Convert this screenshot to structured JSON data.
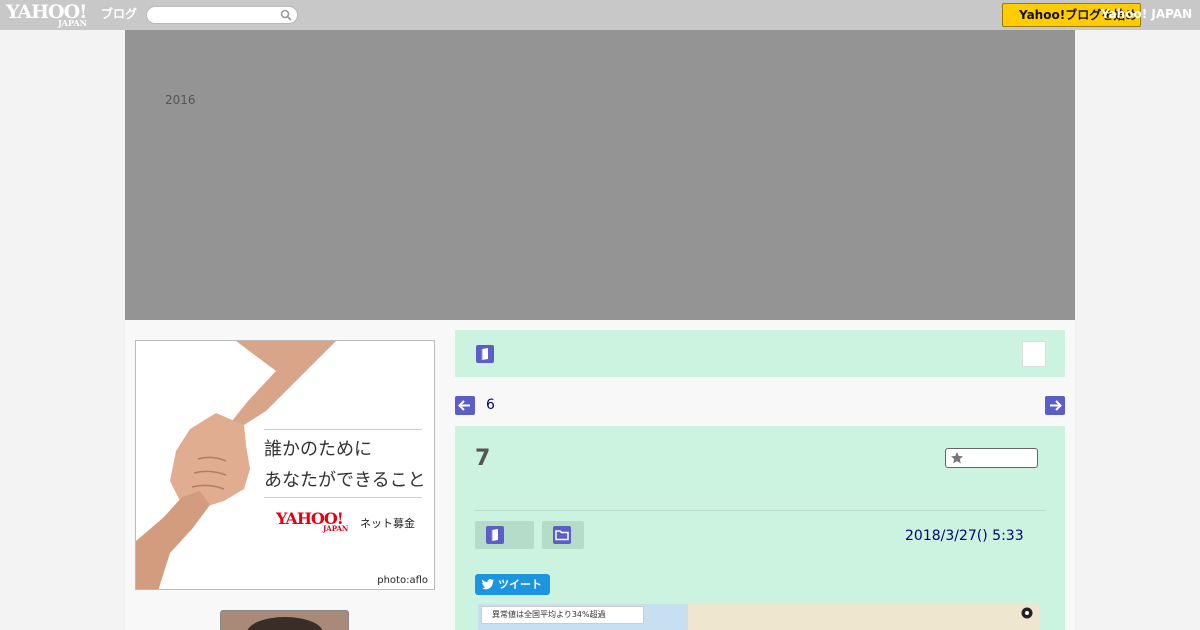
{
  "topbar": {
    "logo_main": "YAHOO!",
    "logo_sub": "JAPAN",
    "logo_blog": "ブログ",
    "search_placeholder": "",
    "button_label": "Yahoo!ブログを始める",
    "link_label": "Yahoo! JAPAN"
  },
  "banner": {
    "year": "2016"
  },
  "sidebar": {
    "ad": {
      "line1": "誰かのために",
      "line2": "あなたができること",
      "logo_main": "YAHOO!",
      "logo_sub": "JAPAN",
      "brand": "ネット募金",
      "credit": "photo:aflo"
    }
  },
  "navigation": {
    "prev_label": "6"
  },
  "article": {
    "title": "7",
    "date": "2018/3/27()  5:33",
    "tweet_label": "ツイート",
    "map_caption": "異常値は全国平均より34%超過"
  },
  "colors": {
    "accent_green": "#ccf3e0",
    "link_navy": "#000080",
    "icon_purple": "#5a5fc7",
    "tweet_blue": "#1b95e0"
  }
}
